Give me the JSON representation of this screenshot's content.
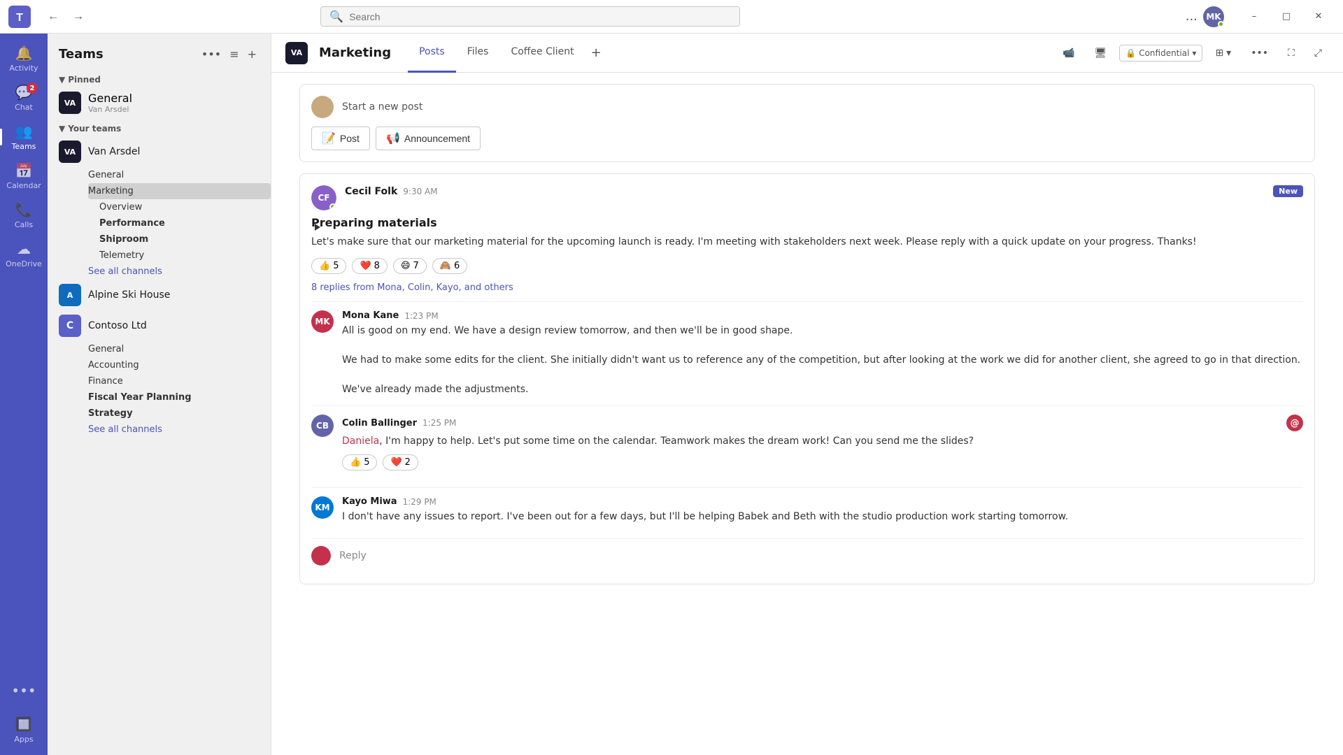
{
  "titlebar": {
    "search_placeholder": "Search",
    "more_label": "...",
    "minimize_label": "–",
    "maximize_label": "□",
    "close_label": "✕"
  },
  "rail": {
    "items": [
      {
        "id": "activity",
        "label": "Activity",
        "icon": "🔔",
        "badge": null,
        "active": false
      },
      {
        "id": "chat",
        "label": "Chat",
        "icon": "💬",
        "badge": "2",
        "active": false
      },
      {
        "id": "teams",
        "label": "Teams",
        "icon": "👥",
        "badge": null,
        "active": true
      },
      {
        "id": "calendar",
        "label": "Calendar",
        "icon": "📅",
        "badge": null,
        "active": false
      },
      {
        "id": "calls",
        "label": "Calls",
        "icon": "📞",
        "badge": null,
        "active": false
      },
      {
        "id": "onedrive",
        "label": "OneDrive",
        "icon": "☁",
        "badge": null,
        "active": false
      }
    ],
    "more_label": "•••",
    "apps_label": "Apps",
    "apps_icon": "🔲"
  },
  "sidebar": {
    "title": "Teams",
    "actions": [
      "•••",
      "≡",
      "+"
    ],
    "pinned_label": "Pinned",
    "pinned_teams": [
      {
        "id": "general-van-arsdel",
        "name": "General",
        "subtitle": "Van Arsdel",
        "avatar_text": "VA",
        "avatar_bg": "#1a1a2e"
      }
    ],
    "your_teams_label": "Your teams",
    "teams": [
      {
        "id": "van-arsdel",
        "name": "Van Arsdel",
        "avatar_text": "VA",
        "avatar_bg": "#1a1a2e",
        "channels": [
          {
            "id": "general",
            "label": "General",
            "bold": false,
            "active": false
          },
          {
            "id": "marketing",
            "label": "Marketing",
            "bold": false,
            "active": true
          },
          {
            "id": "overview",
            "label": "Overview",
            "bold": false,
            "active": false
          },
          {
            "id": "performance",
            "label": "Performance",
            "bold": true,
            "active": false
          },
          {
            "id": "shiproom",
            "label": "Shiproom",
            "bold": true,
            "active": false
          },
          {
            "id": "telemetry",
            "label": "Telemetry",
            "bold": false,
            "active": false
          }
        ],
        "see_all_channels": "See all channels"
      },
      {
        "id": "alpine-ski-house",
        "name": "Alpine Ski House",
        "avatar_text": "A",
        "avatar_bg": "#0f6cbd",
        "channels": [],
        "see_all_channels": null
      },
      {
        "id": "contoso-ltd",
        "name": "Contoso Ltd",
        "avatar_text": "C",
        "avatar_bg": "#5b5fc7",
        "channels": [
          {
            "id": "contoso-general",
            "label": "General",
            "bold": false,
            "active": false
          },
          {
            "id": "accounting",
            "label": "Accounting",
            "bold": false,
            "active": false
          },
          {
            "id": "finance",
            "label": "Finance",
            "bold": false,
            "active": false
          },
          {
            "id": "fiscal-year-planning",
            "label": "Fiscal Year Planning",
            "bold": true,
            "active": false
          },
          {
            "id": "strategy",
            "label": "Strategy",
            "bold": true,
            "active": false
          }
        ],
        "see_all_channels": "See all channels"
      }
    ]
  },
  "channel_header": {
    "avatar_text": "VA",
    "team_name": "Marketing",
    "tabs": [
      {
        "id": "posts",
        "label": "Posts",
        "active": true
      },
      {
        "id": "files",
        "label": "Files",
        "active": false
      },
      {
        "id": "coffee-client",
        "label": "Coffee Client",
        "active": false
      }
    ],
    "add_tab_title": "Add a tab",
    "actions": {
      "video_icon": "📹",
      "screen_icon": "🖥",
      "confidential_label": "Confidential",
      "view_icon": "⊞",
      "more_label": "•••",
      "expand_icon": "⛶",
      "pop_icon": "⤢"
    }
  },
  "composer": {
    "prompt": "Start a new post",
    "buttons": [
      {
        "id": "post-btn",
        "label": "Post",
        "icon": "📝"
      },
      {
        "id": "announcement-btn",
        "label": "Announcement",
        "icon": "📢"
      }
    ]
  },
  "posts": [
    {
      "id": "post-1",
      "author": "Cecil Folk",
      "time": "9:30 AM",
      "is_new": true,
      "new_label": "New",
      "title": "Preparing materials",
      "body": "Let's make sure that our marketing material for the upcoming launch is ready. I'm meeting with stakeholders next week. Please reply with a quick update on your progress. Thanks!",
      "reactions": [
        {
          "emoji": "👍",
          "count": "5"
        },
        {
          "emoji": "❤️",
          "count": "8"
        },
        {
          "emoji": "😄",
          "count": "7"
        },
        {
          "emoji": "🙈",
          "count": "6"
        }
      ],
      "replies_link": "8 replies from Mona, Colin, Kayo, and others",
      "replies": [
        {
          "id": "reply-1",
          "author": "Mona Kane",
          "time": "1:23 PM",
          "avatar_color": "#c4314b",
          "avatar_initials": "MK",
          "body": "All is good on my end. We have a design review tomorrow, and then we'll be in good shape.\n\nWe had to make some edits for the client. She initially didn't want us to reference any of the competition, but after looking at the work we did for another client, she agreed to go in that direction.\n\nWe've already made the adjustments.",
          "reactions": [],
          "at_mention": false
        },
        {
          "id": "reply-2",
          "author": "Colin Ballinger",
          "time": "1:25 PM",
          "avatar_color": "#6264a7",
          "avatar_initials": "CB",
          "body_prefix": "",
          "mention": "Daniela",
          "body_suffix": ", I'm happy to help. Let's put some time on the calendar. Teamwork makes the dream work! Can you send me the slides?",
          "reactions": [
            {
              "emoji": "👍",
              "count": "5"
            },
            {
              "emoji": "❤️",
              "count": "2"
            }
          ],
          "at_mention": true
        },
        {
          "id": "reply-3",
          "author": "Kayo Miwa",
          "time": "1:29 PM",
          "avatar_color": "#0078d4",
          "avatar_initials": "KM",
          "body": "I don't have any issues to report. I've been out for a few days, but I'll be helping Babek and Beth with the studio production work starting tomorrow.",
          "reactions": [],
          "at_mention": false
        }
      ],
      "reply_box_prompt": "Reply"
    }
  ]
}
